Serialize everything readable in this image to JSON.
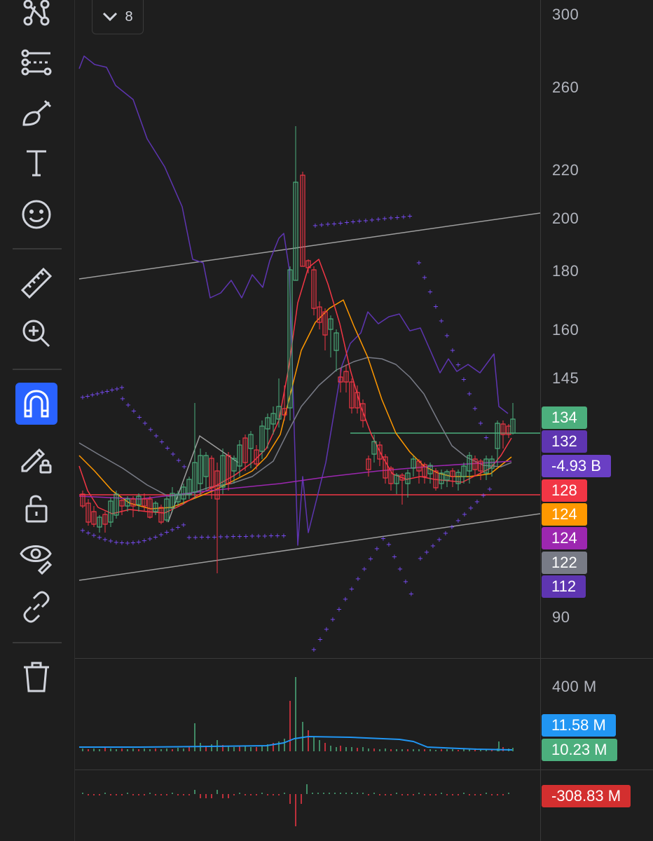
{
  "toolbar": {
    "tools": [
      {
        "name": "pattern-icon",
        "active": false
      },
      {
        "name": "measure-lines-icon",
        "active": false
      },
      {
        "name": "brush-icon",
        "active": false
      },
      {
        "name": "text-icon",
        "active": false
      },
      {
        "name": "emoji-icon",
        "active": false
      },
      {
        "name": "ruler-icon",
        "active": false
      },
      {
        "name": "zoom-in-icon",
        "active": false
      },
      {
        "name": "magnet-icon",
        "active": true
      },
      {
        "name": "lock-drawing-icon",
        "active": false
      },
      {
        "name": "unlock-icon",
        "active": false
      },
      {
        "name": "eye-icon",
        "active": false
      },
      {
        "name": "link-icon",
        "active": false
      },
      {
        "name": "trash-icon",
        "active": false
      }
    ]
  },
  "indicators_toggle": {
    "count": "8",
    "icon": "chevron-down-icon"
  },
  "price_axis": {
    "ticks": [
      "300",
      "260",
      "220",
      "200",
      "180",
      "160",
      "145",
      "90"
    ]
  },
  "price_badges": [
    {
      "label": "134",
      "color": "#4caf7d"
    },
    {
      "label": "132",
      "color": "#5e35b1"
    },
    {
      "label": "-4.93 B",
      "color": "#6a3fc4"
    },
    {
      "label": "128",
      "color": "#f23645"
    },
    {
      "label": "124",
      "color": "#ff9800"
    },
    {
      "label": "124",
      "color": "#9c27b0"
    },
    {
      "label": "122",
      "color": "#787b86"
    },
    {
      "label": "112",
      "color": "#5e35b1"
    }
  ],
  "volume_axis": {
    "tick": "400 M"
  },
  "volume_badges": [
    {
      "label": "11.58 M",
      "color": "#2196f3"
    },
    {
      "label": "10.23 M",
      "color": "#4caf7d"
    }
  ],
  "indicator_badge": {
    "label": "-308.83 M",
    "color": "#d32f2f"
  },
  "colors": {
    "up": "#4caf7d",
    "down": "#f23645",
    "ema_fast": "#f23645",
    "ema_mid": "#ff9800",
    "sma_slow": "#787b86",
    "vwap": "#9c27b0",
    "osc": "#5e35b1",
    "sar": "#7c4dff",
    "volume_ma": "#2196f3"
  }
}
